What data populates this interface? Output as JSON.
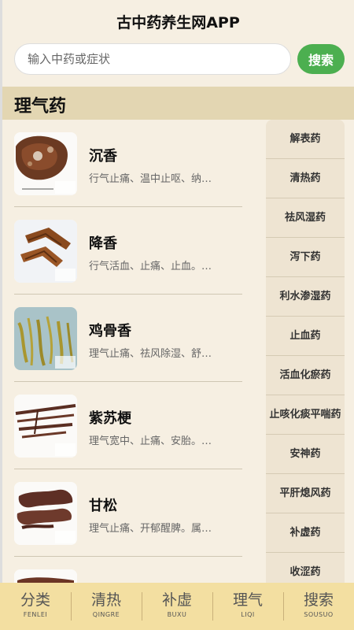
{
  "app": {
    "title": "古中药养生网APP"
  },
  "search": {
    "placeholder": "输入中药或症状",
    "button_label": "搜索"
  },
  "section": {
    "title": "理气药"
  },
  "herbs": [
    {
      "name": "沉香",
      "desc": "行气止痛、温中止呕、纳气平喘。"
    },
    {
      "name": "降香",
      "desc": "行气活血、止痛、止血。属理气药。"
    },
    {
      "name": "鸡骨香",
      "desc": "理气止痛、祛风除湿、舒筋活络。"
    },
    {
      "name": "紫苏梗",
      "desc": "理气宽中、止痛、安胎。属理气药。"
    },
    {
      "name": "甘松",
      "desc": "理气止痛、开郁醒脾。属理气药。"
    }
  ],
  "categories": [
    "解表药",
    "清热药",
    "祛风湿药",
    "泻下药",
    "利水渗湿药",
    "止血药",
    "活血化瘀药",
    "止咳化痰平喘药",
    "安神药",
    "平肝熄风药",
    "补虚药",
    "收涩药"
  ],
  "nav": [
    {
      "label": "分类",
      "sub": "FENLEI"
    },
    {
      "label": "清热",
      "sub": "QINGRE"
    },
    {
      "label": "补虚",
      "sub": "BUXU"
    },
    {
      "label": "理气",
      "sub": "LIQI"
    },
    {
      "label": "搜索",
      "sub": "SOUSUO"
    }
  ]
}
